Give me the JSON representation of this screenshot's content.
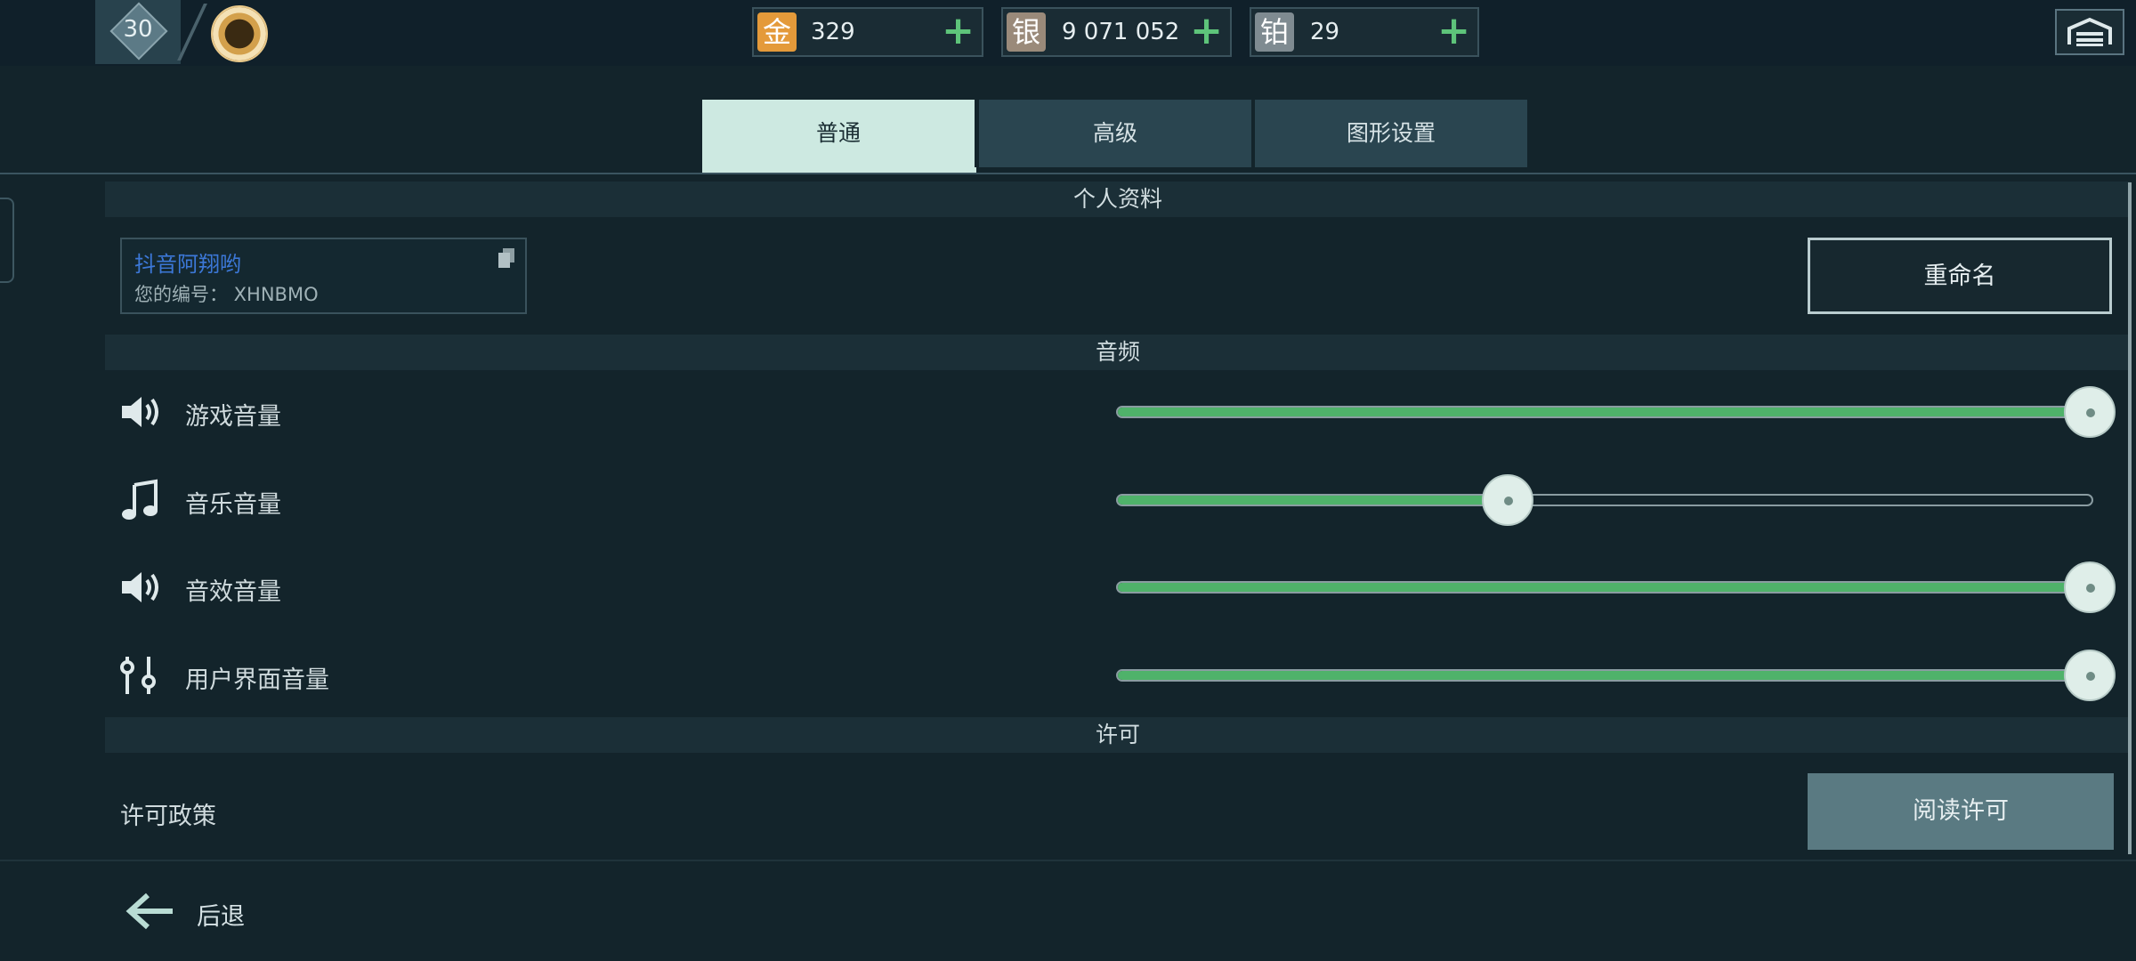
{
  "topbar": {
    "level": "30",
    "currencies": [
      {
        "icon": "金",
        "value": "329",
        "color": "#e49a3a"
      },
      {
        "icon": "银",
        "value": "9 071 052",
        "color": "#9a8a7a"
      },
      {
        "icon": "铂",
        "value": "29",
        "color": "#7f8b91"
      }
    ],
    "add_symbol": "+"
  },
  "tabs": [
    {
      "label": "普通",
      "active": true
    },
    {
      "label": "高级",
      "active": false
    },
    {
      "label": "图形设置",
      "active": false
    }
  ],
  "profile": {
    "header": "个人资料",
    "name": "抖音阿翔哟",
    "id_label": "您的编号： XHNBMO",
    "rename_label": "重命名"
  },
  "audio": {
    "header": "音频",
    "sliders": [
      {
        "label": "游戏音量",
        "icon": "speaker-icon",
        "value": 1.0
      },
      {
        "label": "音乐音量",
        "icon": "music-note-icon",
        "value": 0.4
      },
      {
        "label": "音效音量",
        "icon": "speaker-icon",
        "value": 1.0
      },
      {
        "label": "用户界面音量",
        "icon": "equalizer-icon",
        "value": 1.0
      }
    ]
  },
  "license": {
    "header": "许可",
    "policy_label": "许可政策",
    "read_label": "阅读许可"
  },
  "footer": {
    "back_label": "后退"
  },
  "colors": {
    "accent_green": "#4fb26a",
    "active_tab": "#cde9e1",
    "background": "#13242b"
  }
}
